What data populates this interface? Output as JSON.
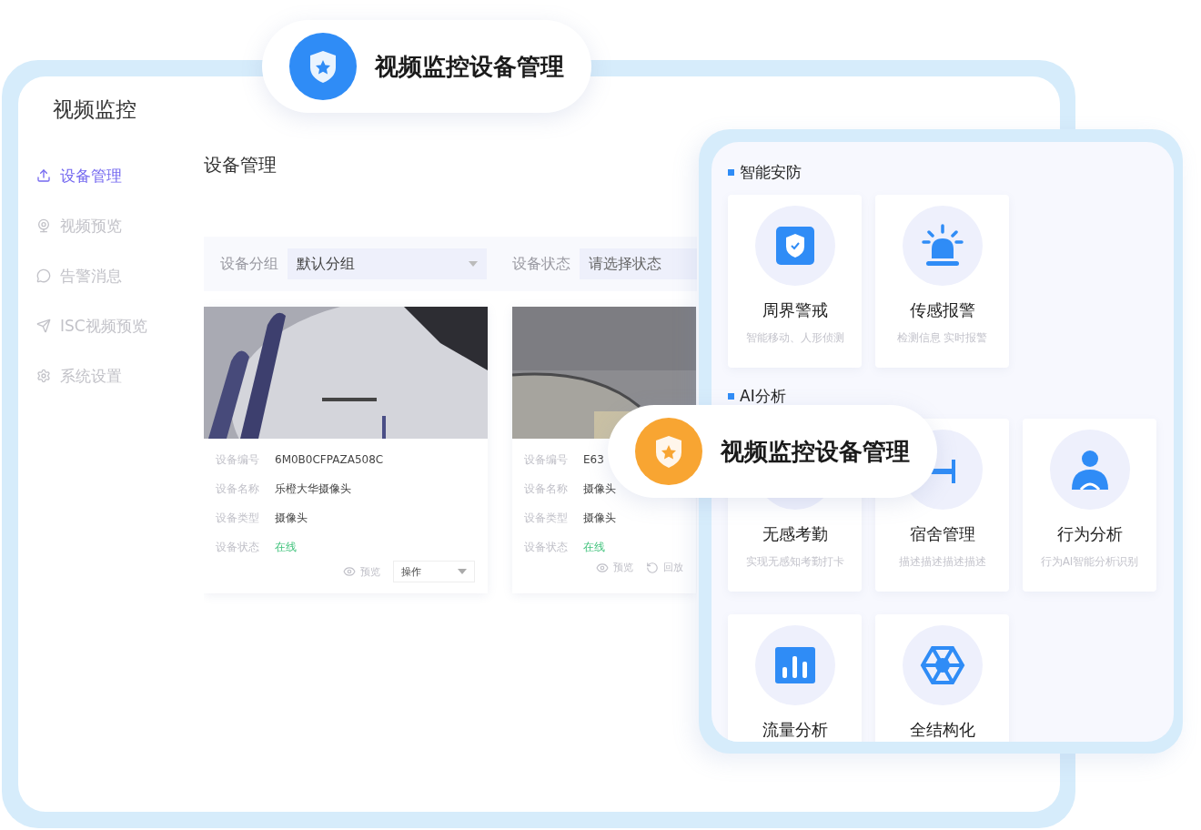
{
  "app": {
    "title": "视频监控",
    "nav": [
      {
        "label": "设备管理",
        "selected": true
      },
      {
        "label": "视频预览",
        "selected": false
      },
      {
        "label": "告警消息",
        "selected": false
      },
      {
        "label": "ISC视频预览",
        "selected": false
      },
      {
        "label": "系统设置",
        "selected": false
      }
    ],
    "page_title": "设备管理",
    "filters": [
      {
        "label": "设备分组",
        "value": "默认分组"
      },
      {
        "label": "设备状态",
        "placeholder": "请选择状态"
      }
    ],
    "devices": [
      {
        "picture": {
          "kind": "picture"
        },
        "fields": [
          {
            "label": "设备编号",
            "value": "6M0B0CFPAZA508C",
            "kind": "text"
          },
          {
            "label": "设备名称",
            "value": "乐橙大华摄像头",
            "kind": "text"
          },
          {
            "label": "设备类型",
            "value": "摄像头",
            "kind": "text"
          },
          {
            "label": "设备状态",
            "value": "在线",
            "kind": "status"
          }
        ],
        "actions": [
          {
            "kind": "preview",
            "label": "预览"
          },
          {
            "kind": "dropdown",
            "label": "操作"
          }
        ]
      },
      {
        "picture": {
          "kind": "picture"
        },
        "fields": [
          {
            "label": "设备编号",
            "value": "E63",
            "kind": "text"
          },
          {
            "label": "设备名称",
            "value": "摄像头",
            "kind": "text"
          },
          {
            "label": "设备类型",
            "value": "摄像头",
            "kind": "text"
          },
          {
            "label": "设备状态",
            "value": "在线",
            "kind": "status"
          }
        ],
        "actions": [
          {
            "kind": "preview",
            "label": "预览"
          },
          {
            "kind": "replay",
            "label": "回放"
          }
        ]
      }
    ]
  },
  "features": {
    "sections": [
      {
        "title": "智能安防",
        "items": [
          {
            "title": "周界警戒",
            "desc": "智能移动、人形侦测"
          },
          {
            "title": "传感报警",
            "desc": "检测信息 实时报警"
          }
        ]
      },
      {
        "title": "AI分析",
        "items": [
          {
            "title": "无感考勤",
            "desc": "实现无感知考勤打卡"
          },
          {
            "title": "宿舍管理",
            "desc": "描述描述描述描述"
          },
          {
            "title": "行为分析",
            "desc": "行为AI智能分析识别"
          },
          {
            "title": "流量分析"
          },
          {
            "title": "全结构化"
          }
        ]
      }
    ]
  },
  "banners": [
    {
      "title": "视频监控设备管理",
      "color": "#2f8cf6"
    },
    {
      "title": "视频监控设备管理",
      "color": "#f8a532"
    }
  ]
}
